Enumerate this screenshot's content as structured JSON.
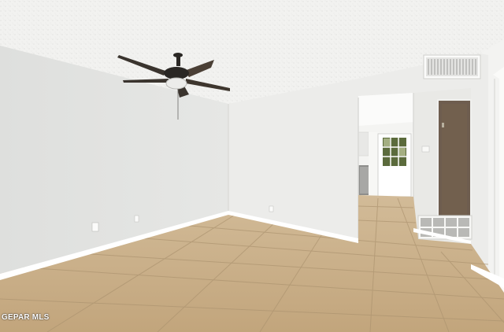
{
  "photo": {
    "watermark": "GEPAR MLS",
    "colors": {
      "ceiling": "#f2f2f0",
      "left_wall": "#e3e4e2",
      "back_wall": "#ececea",
      "right_wall": "#f3f3f1",
      "floor": "#c9b08a",
      "grout": "#ad9470",
      "baseboard": "#ffffff",
      "door_brown": "#6e5d4f",
      "fan_dark": "#2a2724"
    }
  }
}
